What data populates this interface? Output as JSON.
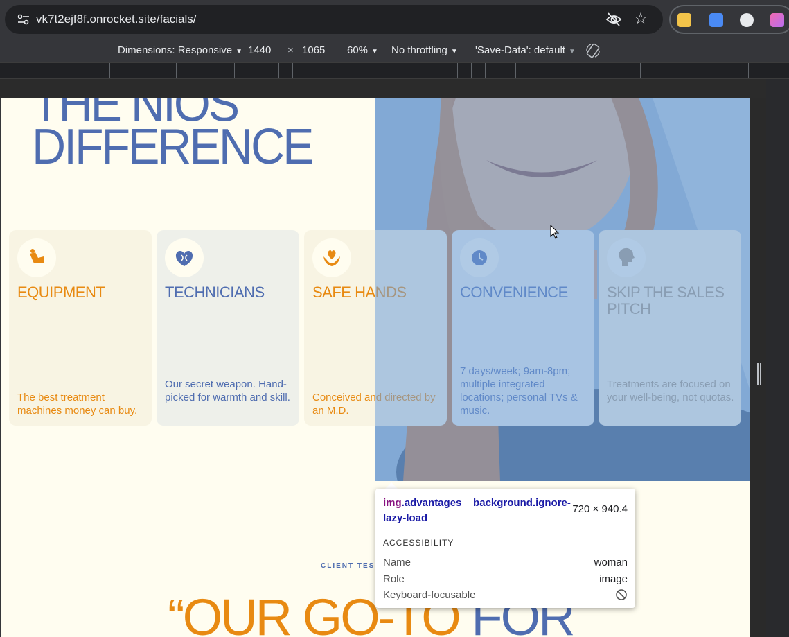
{
  "browser": {
    "url": "vk7t2ejf8f.onrocket.site/facials/",
    "icons": [
      "site-info-icon",
      "eye-off-icon",
      "star-icon",
      "extension-icons"
    ]
  },
  "devtools": {
    "dimensions_label": "Dimensions: Responsive",
    "width": "1440",
    "times": "×",
    "height": "1065",
    "zoom": "60%",
    "throttling": "No throttling",
    "save_data": "'Save-Data': default"
  },
  "page": {
    "hero_line1": "THE NIOS",
    "hero_line2": "DIFFERENCE",
    "cards": [
      {
        "title": "EQUIPMENT",
        "text": "The best treatment machines money can buy.",
        "color": "#e88a12",
        "bg": "#f8f4e3",
        "icon": "arm-icon"
      },
      {
        "title": "TECHNICIANS",
        "text": "Our secret weapon. Hand-picked for warmth and skill.",
        "color": "#4f6db0",
        "bg": "#eef0ea",
        "icon": "brain-heart-icon"
      },
      {
        "title": "SAFE HANDS",
        "text": "Conceived and directed by an M.D.",
        "color": "#e88a12",
        "bg": "#f8f4e3",
        "icon": "hands-heart-icon"
      },
      {
        "title": "CONVENIENCE",
        "text": "7 days/week; 9am-8pm; multiple integrated locations; personal TVs & music.",
        "color": "#4f6db0",
        "bg": "#eef0ea",
        "icon": "clock-icon"
      },
      {
        "title": "SKIP THE SALES PITCH",
        "text": "Treatments are focused on your well-being, not quotas.",
        "color": "#a89a80",
        "bg": "#f8f4e3",
        "icon": "head-icon"
      }
    ],
    "client_label": "CLIENT TES",
    "quote_part1": "“OUR GO-TO",
    "quote_part2": "FOR",
    "orange": "#e88a12",
    "blue": "#4f6db0"
  },
  "inspector": {
    "tag": "img",
    "classes": ".advantages__background.ignore-lazy-load",
    "size": "720 × 940.4",
    "section": "ACCESSIBILITY",
    "rows": [
      {
        "label": "Name",
        "value": "woman"
      },
      {
        "label": "Role",
        "value": "image"
      },
      {
        "label": "Keyboard-focusable",
        "value": "⃠"
      }
    ]
  }
}
